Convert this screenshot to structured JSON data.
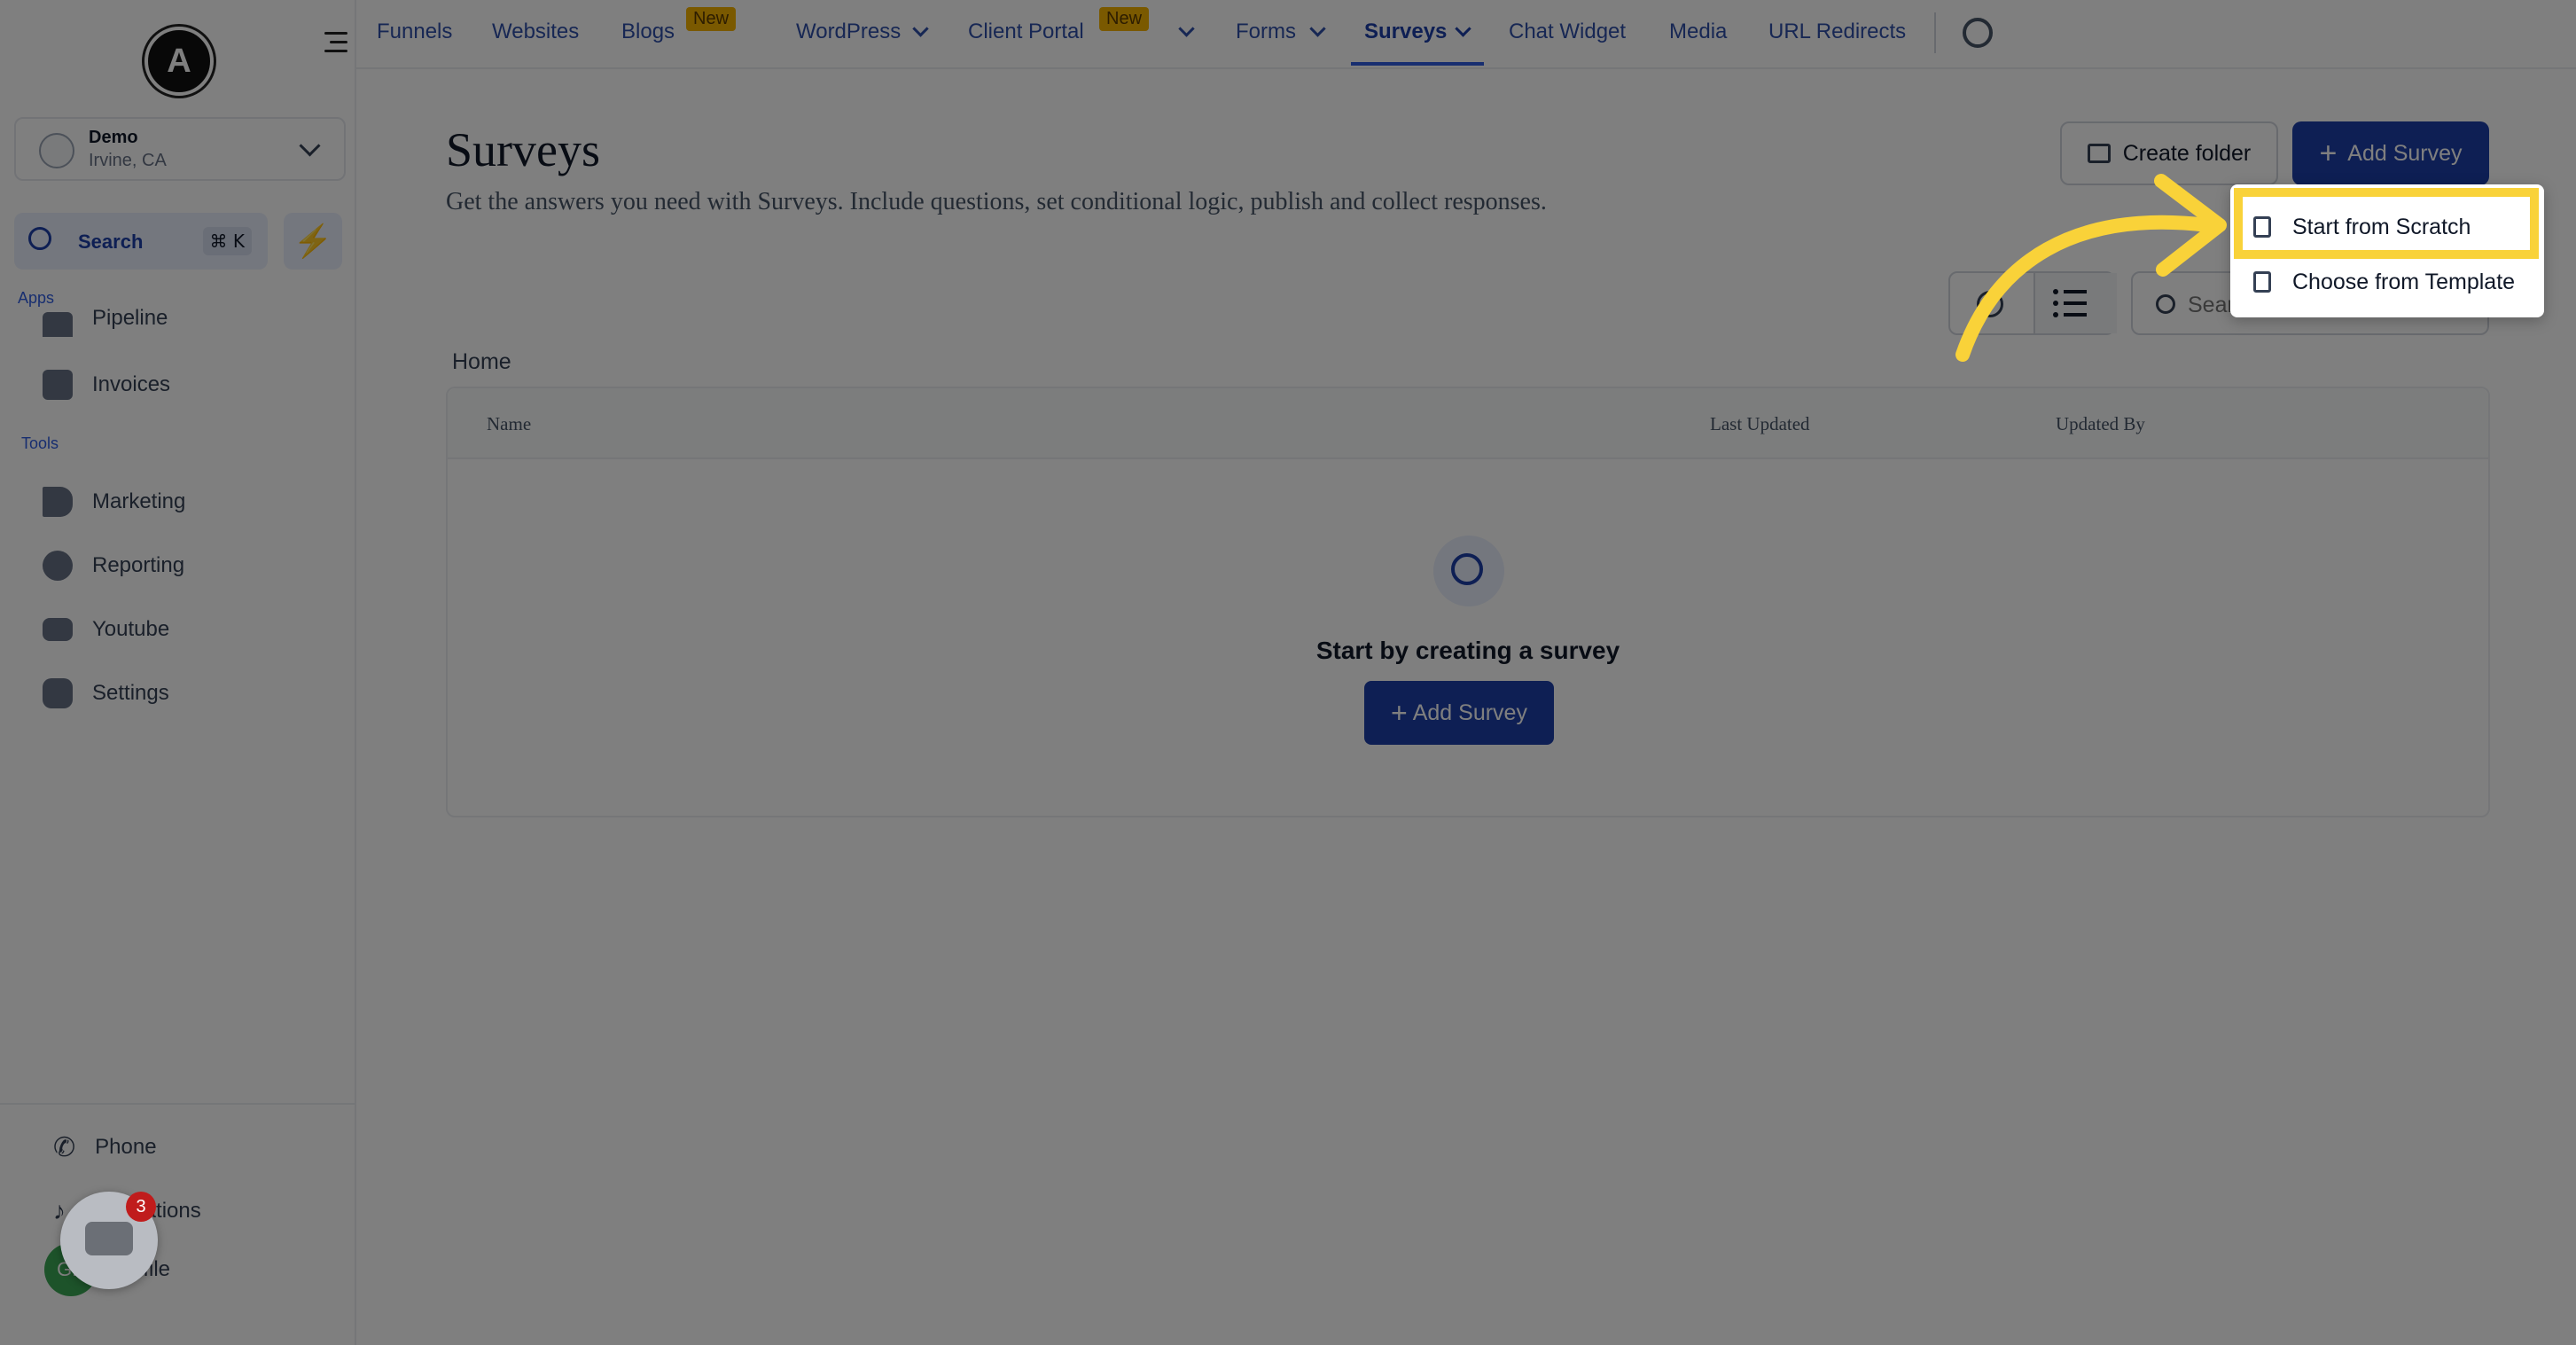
{
  "sidebar": {
    "logo_letter": "A",
    "account": {
      "name": "Demo",
      "location": "Irvine, CA"
    },
    "search": {
      "label": "Search",
      "shortcut": "⌘ K"
    },
    "apps_label": "Apps",
    "apps_items": [
      {
        "label": "Pipeline"
      },
      {
        "label": "Invoices"
      }
    ],
    "tools_label": "Tools",
    "tools_items": [
      {
        "label": "Marketing"
      },
      {
        "label": "Reporting"
      },
      {
        "label": "Youtube"
      },
      {
        "label": "Settings"
      }
    ],
    "bottom_items": [
      {
        "label": "Phone"
      },
      {
        "label": "Notifications"
      },
      {
        "label": "Profile"
      }
    ],
    "profile_initials": "GP",
    "chat_widget_count": "3"
  },
  "topnav": {
    "items": [
      {
        "label": "Funnels"
      },
      {
        "label": "Websites"
      },
      {
        "label": "Blogs",
        "badge": "New"
      },
      {
        "label": "WordPress"
      },
      {
        "label": "Client Portal",
        "badge": "New"
      },
      {
        "label": "Forms"
      },
      {
        "label": "Surveys",
        "active": true
      },
      {
        "label": "Chat Widget"
      },
      {
        "label": "Media"
      },
      {
        "label": "URL Redirects"
      }
    ]
  },
  "main": {
    "title": "Surveys",
    "subtitle": "Get the answers you need with Surveys. Include questions, set conditional logic, publish and collect responses.",
    "create_folder_label": "Create folder",
    "add_survey_label": "Add Survey",
    "search_placeholder": "Search",
    "breadcrumb": "Home",
    "table": {
      "columns": [
        "Name",
        "Last Updated",
        "Updated By"
      ],
      "empty_title": "Start by creating a survey",
      "empty_button": "Add Survey"
    }
  },
  "dropdown": {
    "items": [
      {
        "label": "Start from Scratch"
      },
      {
        "label": "Choose from Template"
      }
    ]
  },
  "colors": {
    "primary": "#1d3fa8",
    "highlight": "#f9d239",
    "badge": "#f5b300",
    "notification": "#c01c1c"
  }
}
